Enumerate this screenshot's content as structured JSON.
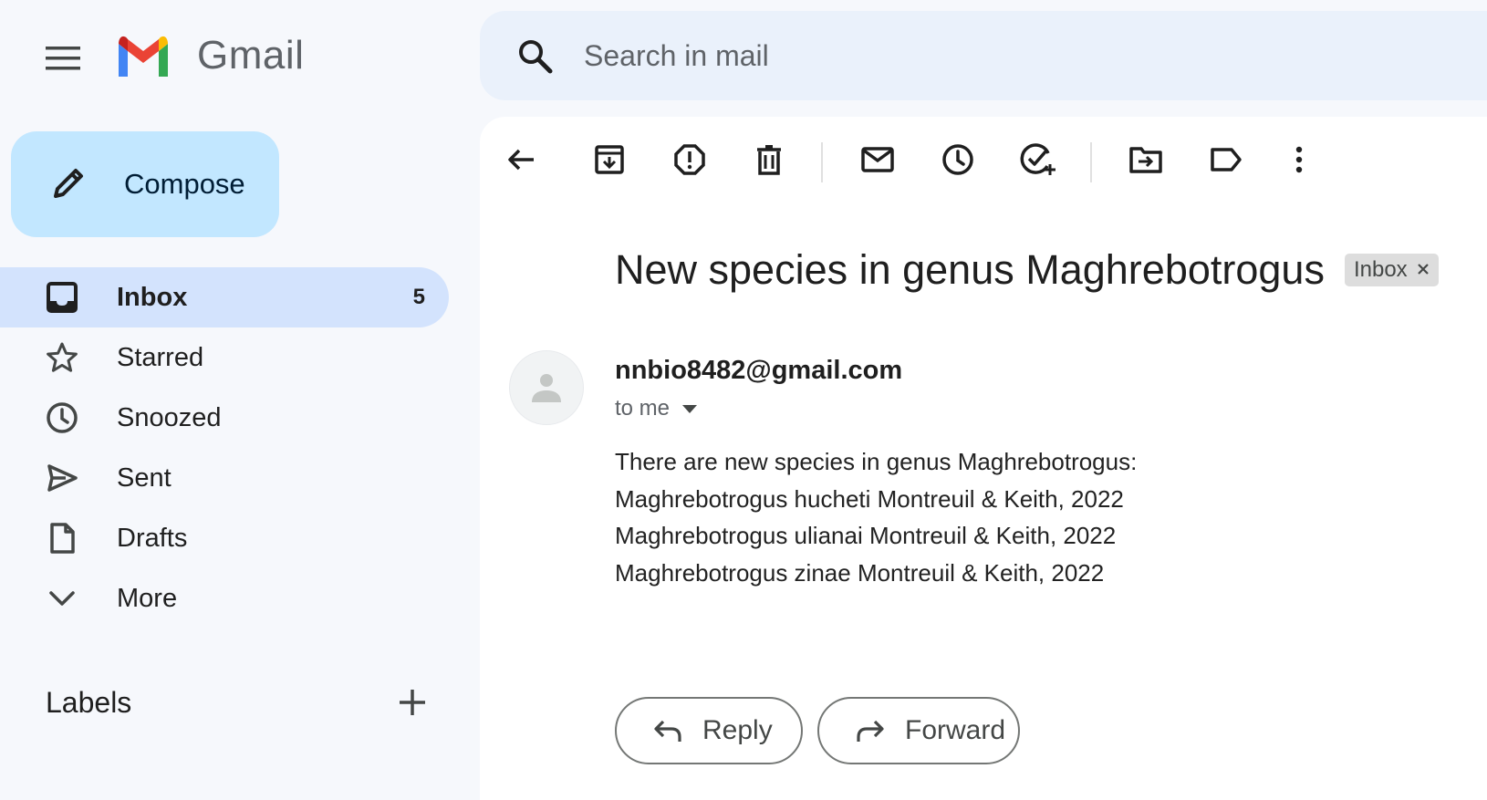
{
  "app": {
    "name": "Gmail"
  },
  "search": {
    "placeholder": "Search in mail"
  },
  "compose": {
    "label": "Compose"
  },
  "nav": {
    "items": [
      {
        "label": "Inbox",
        "count": "5",
        "icon": "inbox-icon",
        "active": true
      },
      {
        "label": "Starred",
        "icon": "star-icon"
      },
      {
        "label": "Snoozed",
        "icon": "clock-icon"
      },
      {
        "label": "Sent",
        "icon": "send-icon"
      },
      {
        "label": "Drafts",
        "icon": "draft-icon"
      },
      {
        "label": "More",
        "icon": "chevron-down-icon"
      }
    ]
  },
  "labels": {
    "title": "Labels"
  },
  "toolbar": {
    "icons": [
      "back-arrow-icon",
      "archive-icon",
      "report-spam-icon",
      "delete-icon",
      "mark-unread-icon",
      "snooze-icon",
      "add-task-icon",
      "move-to-icon",
      "label-icon",
      "more-vert-icon"
    ]
  },
  "email": {
    "subject": "New species in genus Maghrebotrogus",
    "chip": "Inbox",
    "sender": "nnbio8482@gmail.com",
    "to": "to me",
    "body": [
      "There are new species in genus Maghrebotrogus:",
      "Maghrebotrogus hucheti Montreuil & Keith, 2022",
      "Maghrebotrogus ulianai Montreuil & Keith, 2022",
      "Maghrebotrogus zinae Montreuil & Keith, 2022"
    ]
  },
  "actions": {
    "reply": "Reply",
    "forward": "Forward"
  },
  "colors": {
    "compose_bg": "#c2e7ff",
    "active_nav_bg": "#d3e3fd",
    "search_bg": "#eaf1fb",
    "app_bg": "#f6f8fc"
  }
}
